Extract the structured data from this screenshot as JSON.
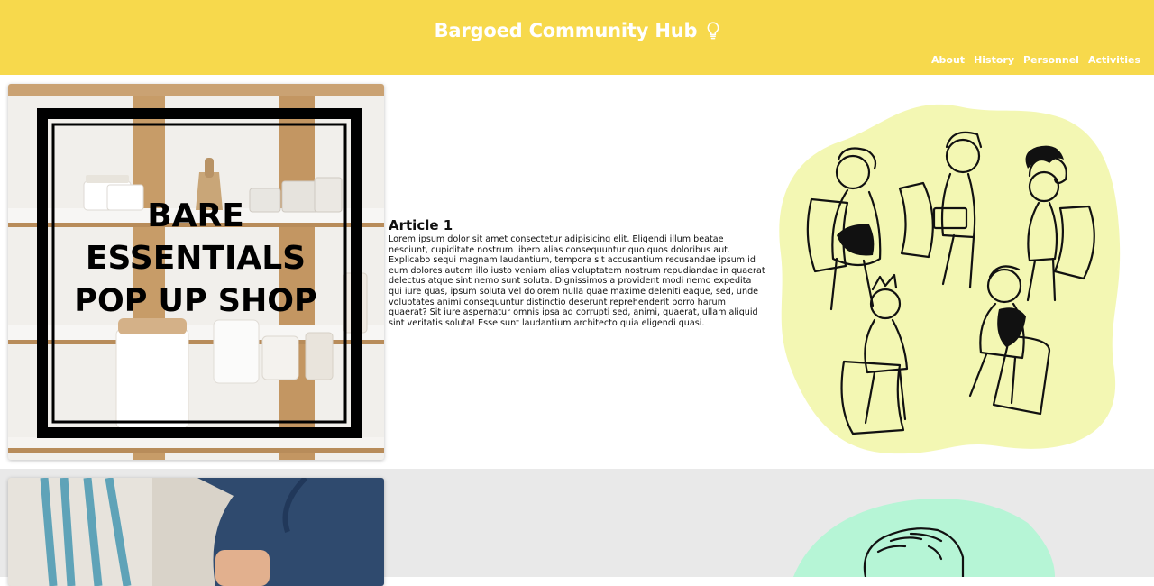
{
  "header": {
    "title": "Bargoed Community Hub",
    "nav": [
      "About",
      "History",
      "Personnel",
      "Activities"
    ]
  },
  "articles": [
    {
      "poster_text": [
        "BARE",
        "ESSENTIALS",
        "POP UP SHOP"
      ],
      "title": "Article 1",
      "body": "Lorem ipsum dolor sit amet consectetur adipisicing elit. Eligendi illum beatae nesciunt, cupiditate nostrum libero alias consequuntur quo quos doloribus aut. Explicabo sequi magnam laudantium, tempora sit accusantium recusandae ipsum id eum dolores autem illo iusto veniam alias voluptatem nostrum repudiandae in quaerat delectus atque sint nemo sunt soluta. Dignissimos a provident modi nemo expedita qui iure quas, ipsum soluta vel dolorem nulla quae maxime deleniti eaque, sed, unde voluptates animi consequuntur distinctio deserunt reprehenderit porro harum quaerat? Sit iure aspernatur omnis ipsa ad corrupti sed, animi, quaerat, ullam aliquid sint veritatis soluta! Esse sunt laudantium architecto quia eligendi quasi."
    }
  ],
  "colors": {
    "header_bg": "#f7d94c",
    "blob_yellow": "#f3f7b3",
    "blob_mint": "#b6f5d6",
    "section_alt_bg": "#e9e9e9"
  },
  "icons": {
    "title_icon": "lightbulb-icon"
  }
}
